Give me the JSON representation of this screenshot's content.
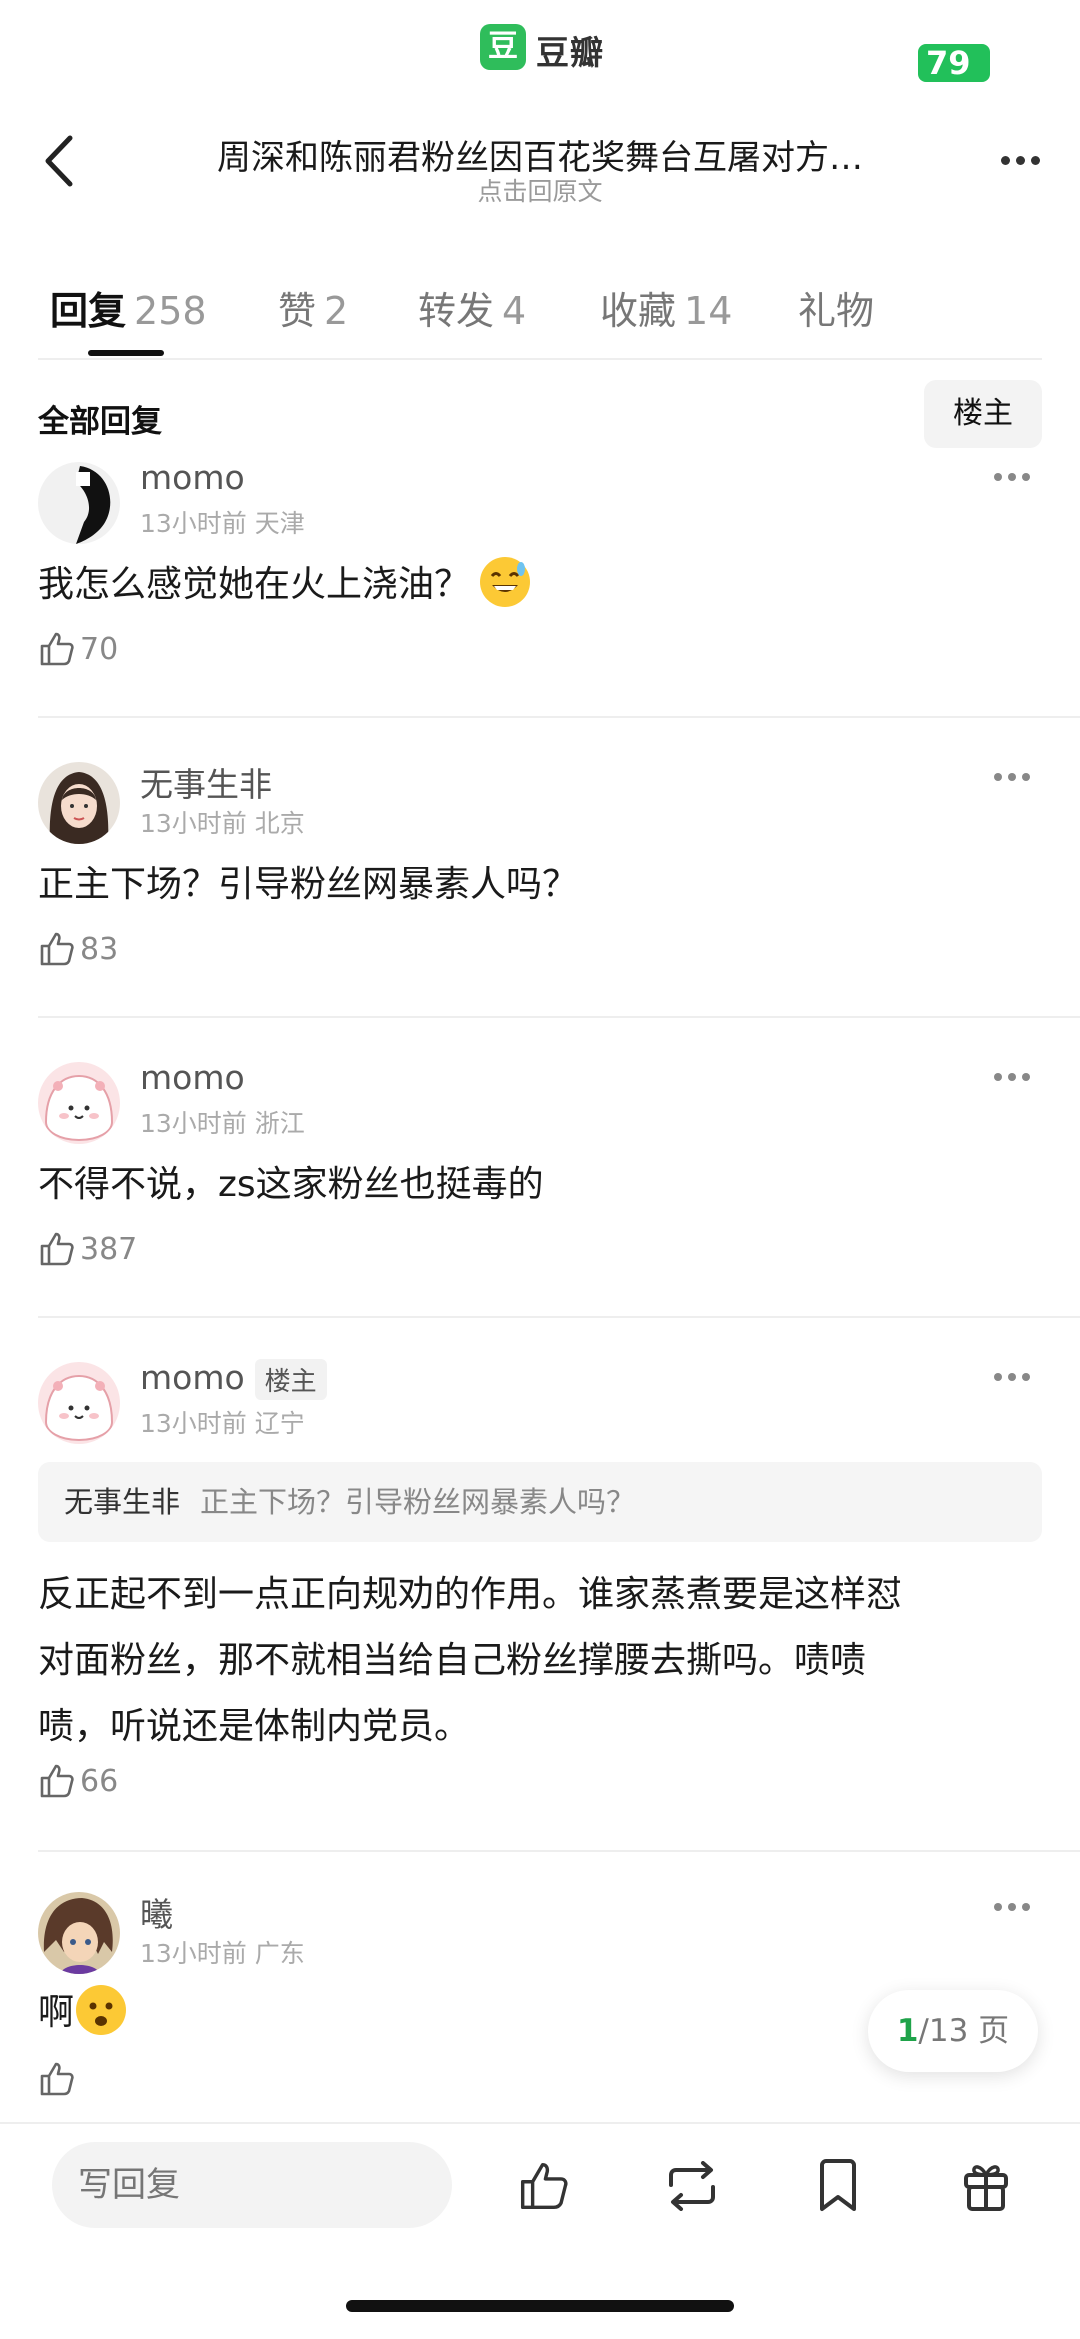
{
  "status": {
    "brand_logo": "豆",
    "brand_name": "豆瓣",
    "badge": "79"
  },
  "header": {
    "title": "周深和陈丽君粉丝因百花奖舞台互屠对方…",
    "subtitle": "点击回原文"
  },
  "tabs": [
    {
      "label": "回复",
      "count": "258",
      "active": true
    },
    {
      "label": "赞",
      "count": "2"
    },
    {
      "label": "转发",
      "count": "4"
    },
    {
      "label": "收藏",
      "count": "14"
    },
    {
      "label": "礼物",
      "count": ""
    }
  ],
  "filter": {
    "label": "全部回复",
    "op_button": "楼主"
  },
  "comments": [
    {
      "name": "momo",
      "time": "13小时前",
      "location": "天津",
      "text": "我怎么感觉她在火上浇油？",
      "emoji": "sweat-smile-emoji",
      "likes": "70"
    },
    {
      "name": "无事生非",
      "time": "13小时前",
      "location": "北京",
      "text": "正主下场？引导粉丝网暴素人吗？",
      "likes": "83"
    },
    {
      "name": "momo",
      "time": "13小时前",
      "location": "浙江",
      "text": "不得不说，zs这家粉丝也挺毒的",
      "likes": "387"
    },
    {
      "name": "momo",
      "op_tag": "楼主",
      "time": "13小时前",
      "location": "辽宁",
      "quote": {
        "name": "无事生非",
        "text": "正主下场？引导粉丝网暴素人吗？"
      },
      "text_lines": [
        "反正起不到一点正向规劝的作用。谁家蒸煮要是这样怼",
        "对面粉丝，那不就相当给自己粉丝撑腰去撕吗。啧啧",
        "啧，听说还是体制内党员。"
      ],
      "likes": "66"
    },
    {
      "name": "曦",
      "time": "13小时前",
      "location": "广东",
      "text": "啊",
      "emoji": "frown-emoji",
      "likes": ""
    }
  ],
  "pager": {
    "current": "1",
    "total": "/13 页"
  },
  "bottom": {
    "reply_placeholder": "写回复"
  },
  "colors": {
    "brand_green": "#2fbd5b",
    "pager_current": "#1fa34a"
  }
}
